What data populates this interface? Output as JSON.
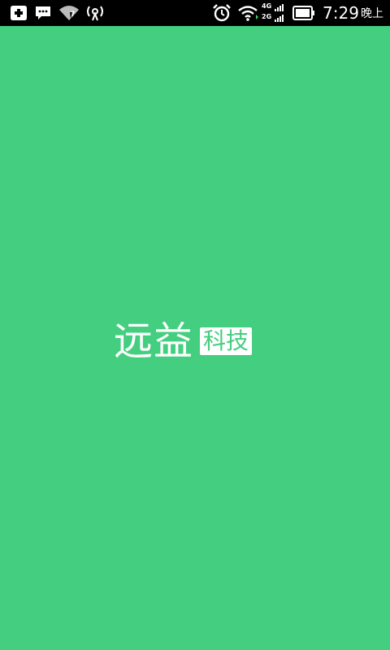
{
  "status_bar": {
    "left_icons": [
      "plus-circle-icon",
      "message-icon",
      "wifi-disabled-icon",
      "broadcast-icon"
    ],
    "right_icons": [
      "alarm-icon",
      "wifi-icon",
      "signal-icon",
      "battery-icon"
    ],
    "network_top": "4G",
    "network_bottom": "2G",
    "time": "7:29",
    "time_suffix": "晚上"
  },
  "splash": {
    "brand_main": "远益",
    "brand_badge": "科技"
  },
  "colors": {
    "background": "#44ce7f",
    "status_bar": "#000000",
    "text": "#ffffff"
  }
}
